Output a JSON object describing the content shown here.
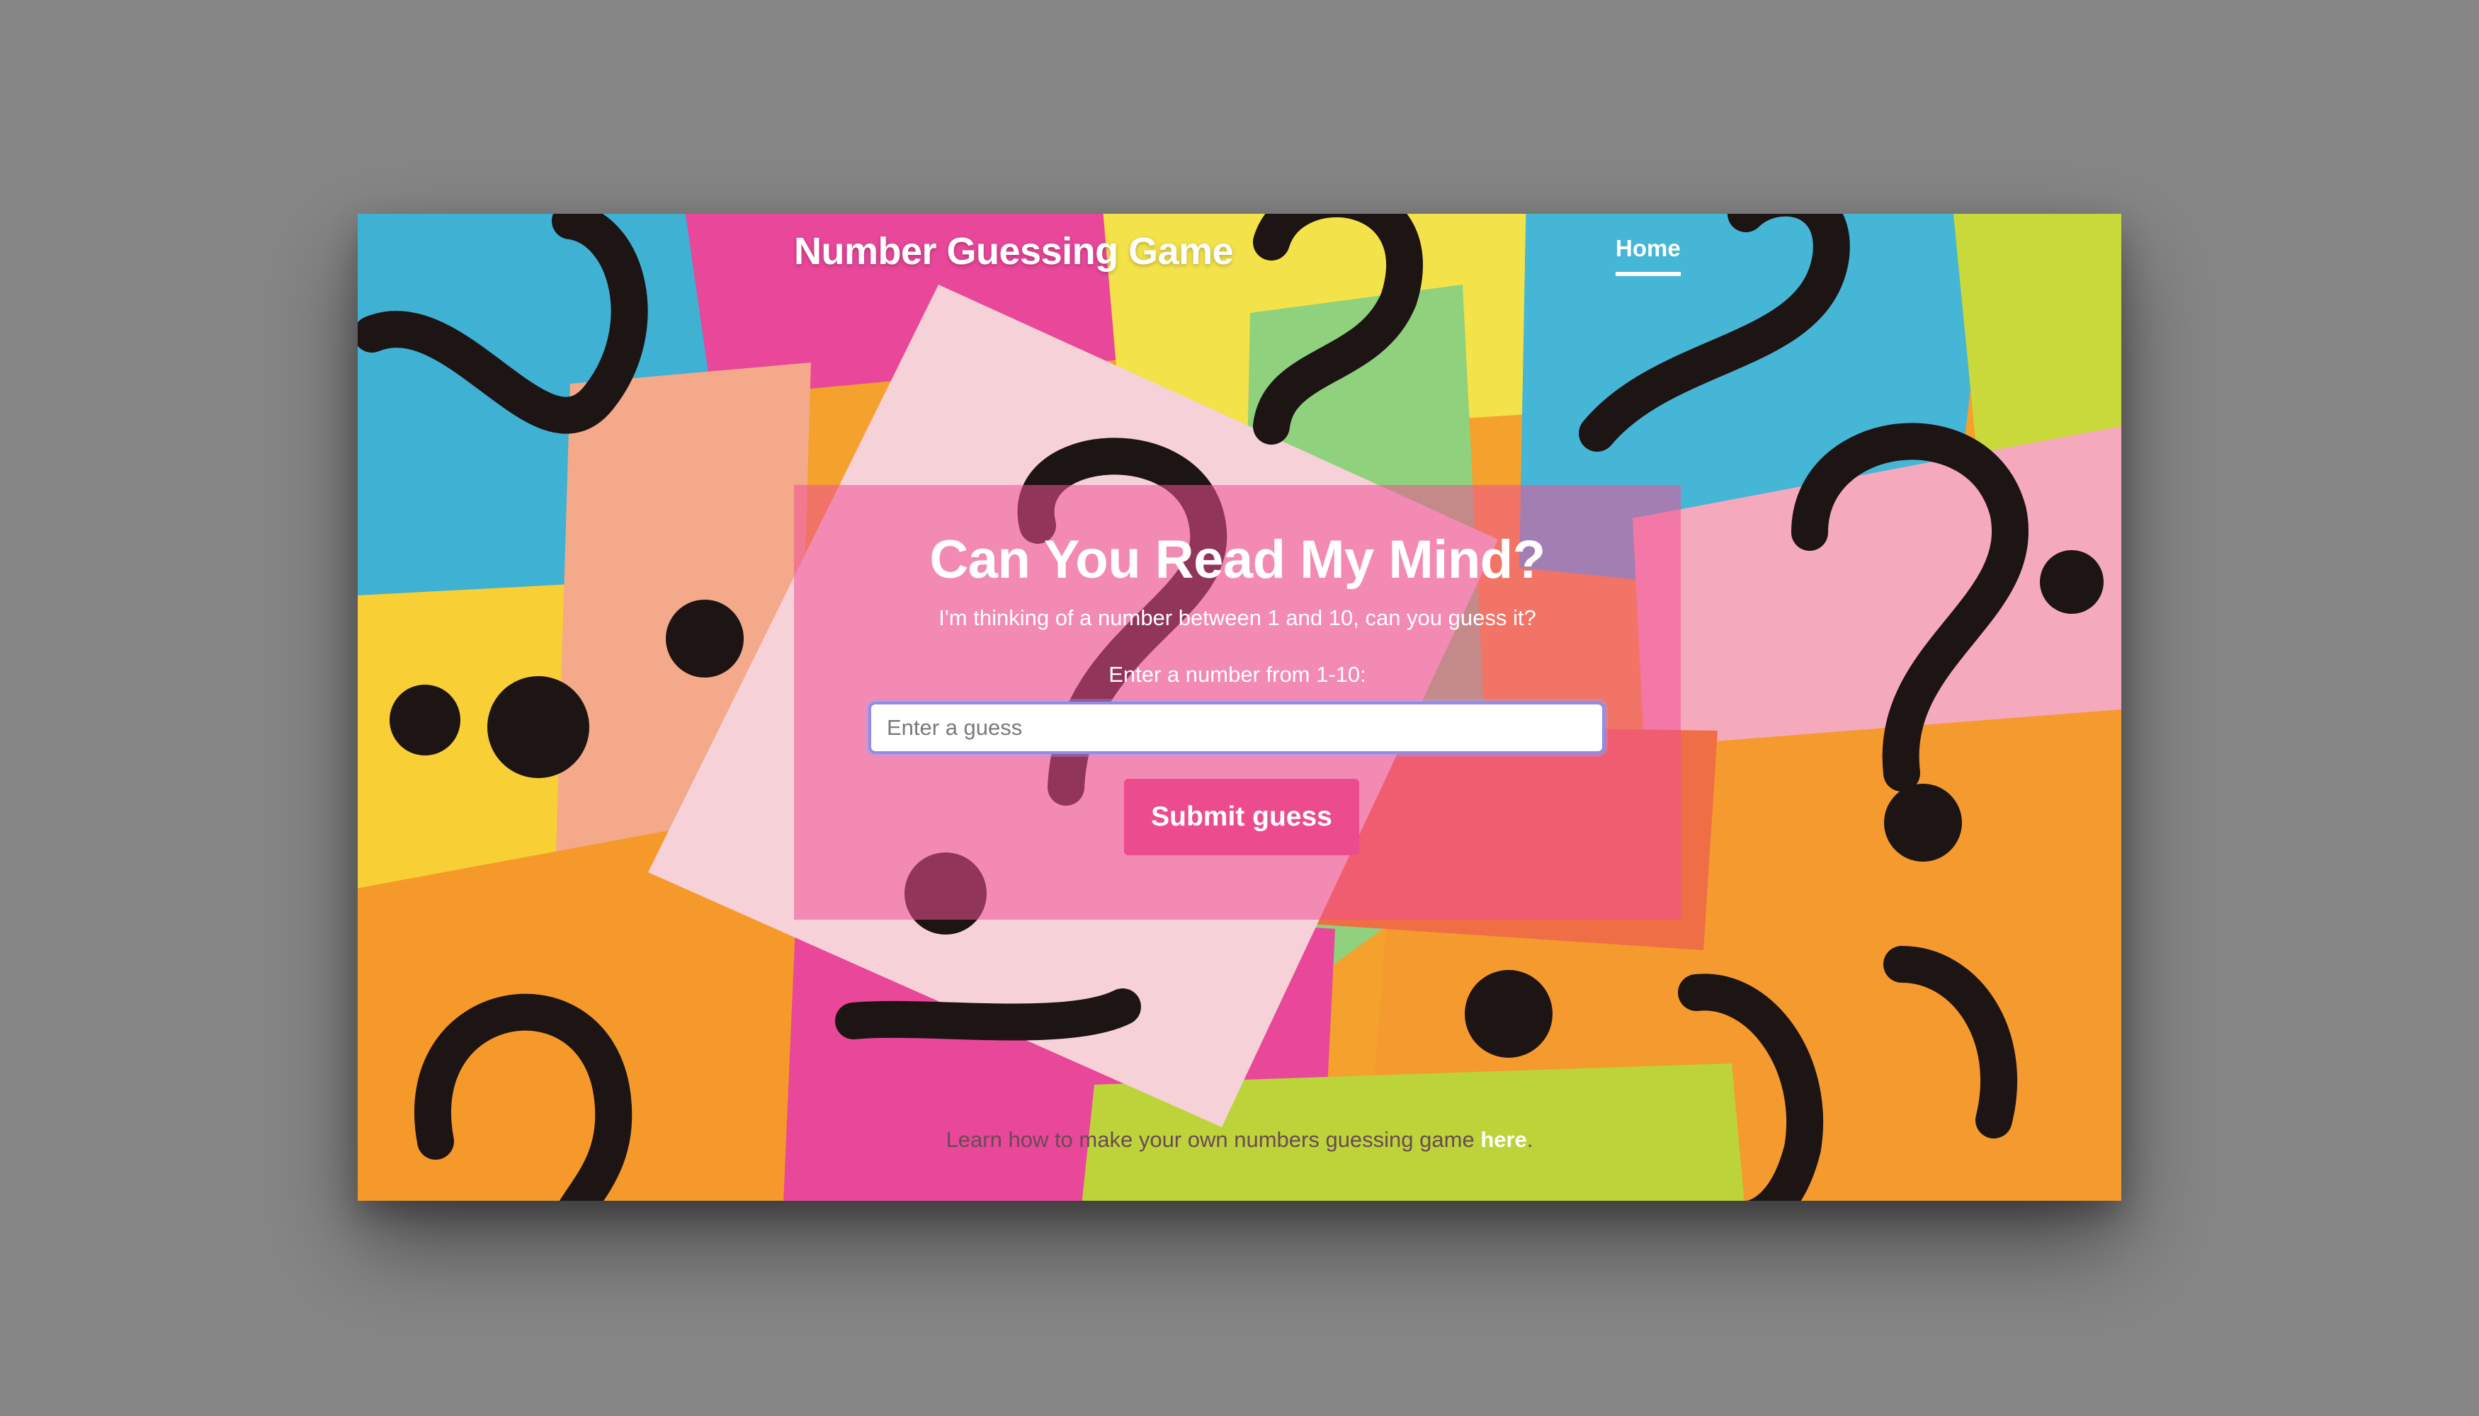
{
  "header": {
    "brand": "Number Guessing Game",
    "nav": [
      {
        "label": "Home",
        "active": true
      }
    ]
  },
  "game": {
    "title": "Can You Read My Mind?",
    "lead": "I'm thinking of a number between 1 and 10, can you guess it?",
    "input_label": "Enter a number from 1-10:",
    "input_placeholder": "Enter a guess",
    "input_value": "",
    "submit_label": "Submit guess"
  },
  "footer": {
    "text": "Learn how to make your own numbers guessing game ",
    "link_label": "here",
    "suffix": "."
  },
  "colors": {
    "accent": "#ec4b8e",
    "card_overlay": "#f05096",
    "input_focus": "#8e8ee6"
  }
}
